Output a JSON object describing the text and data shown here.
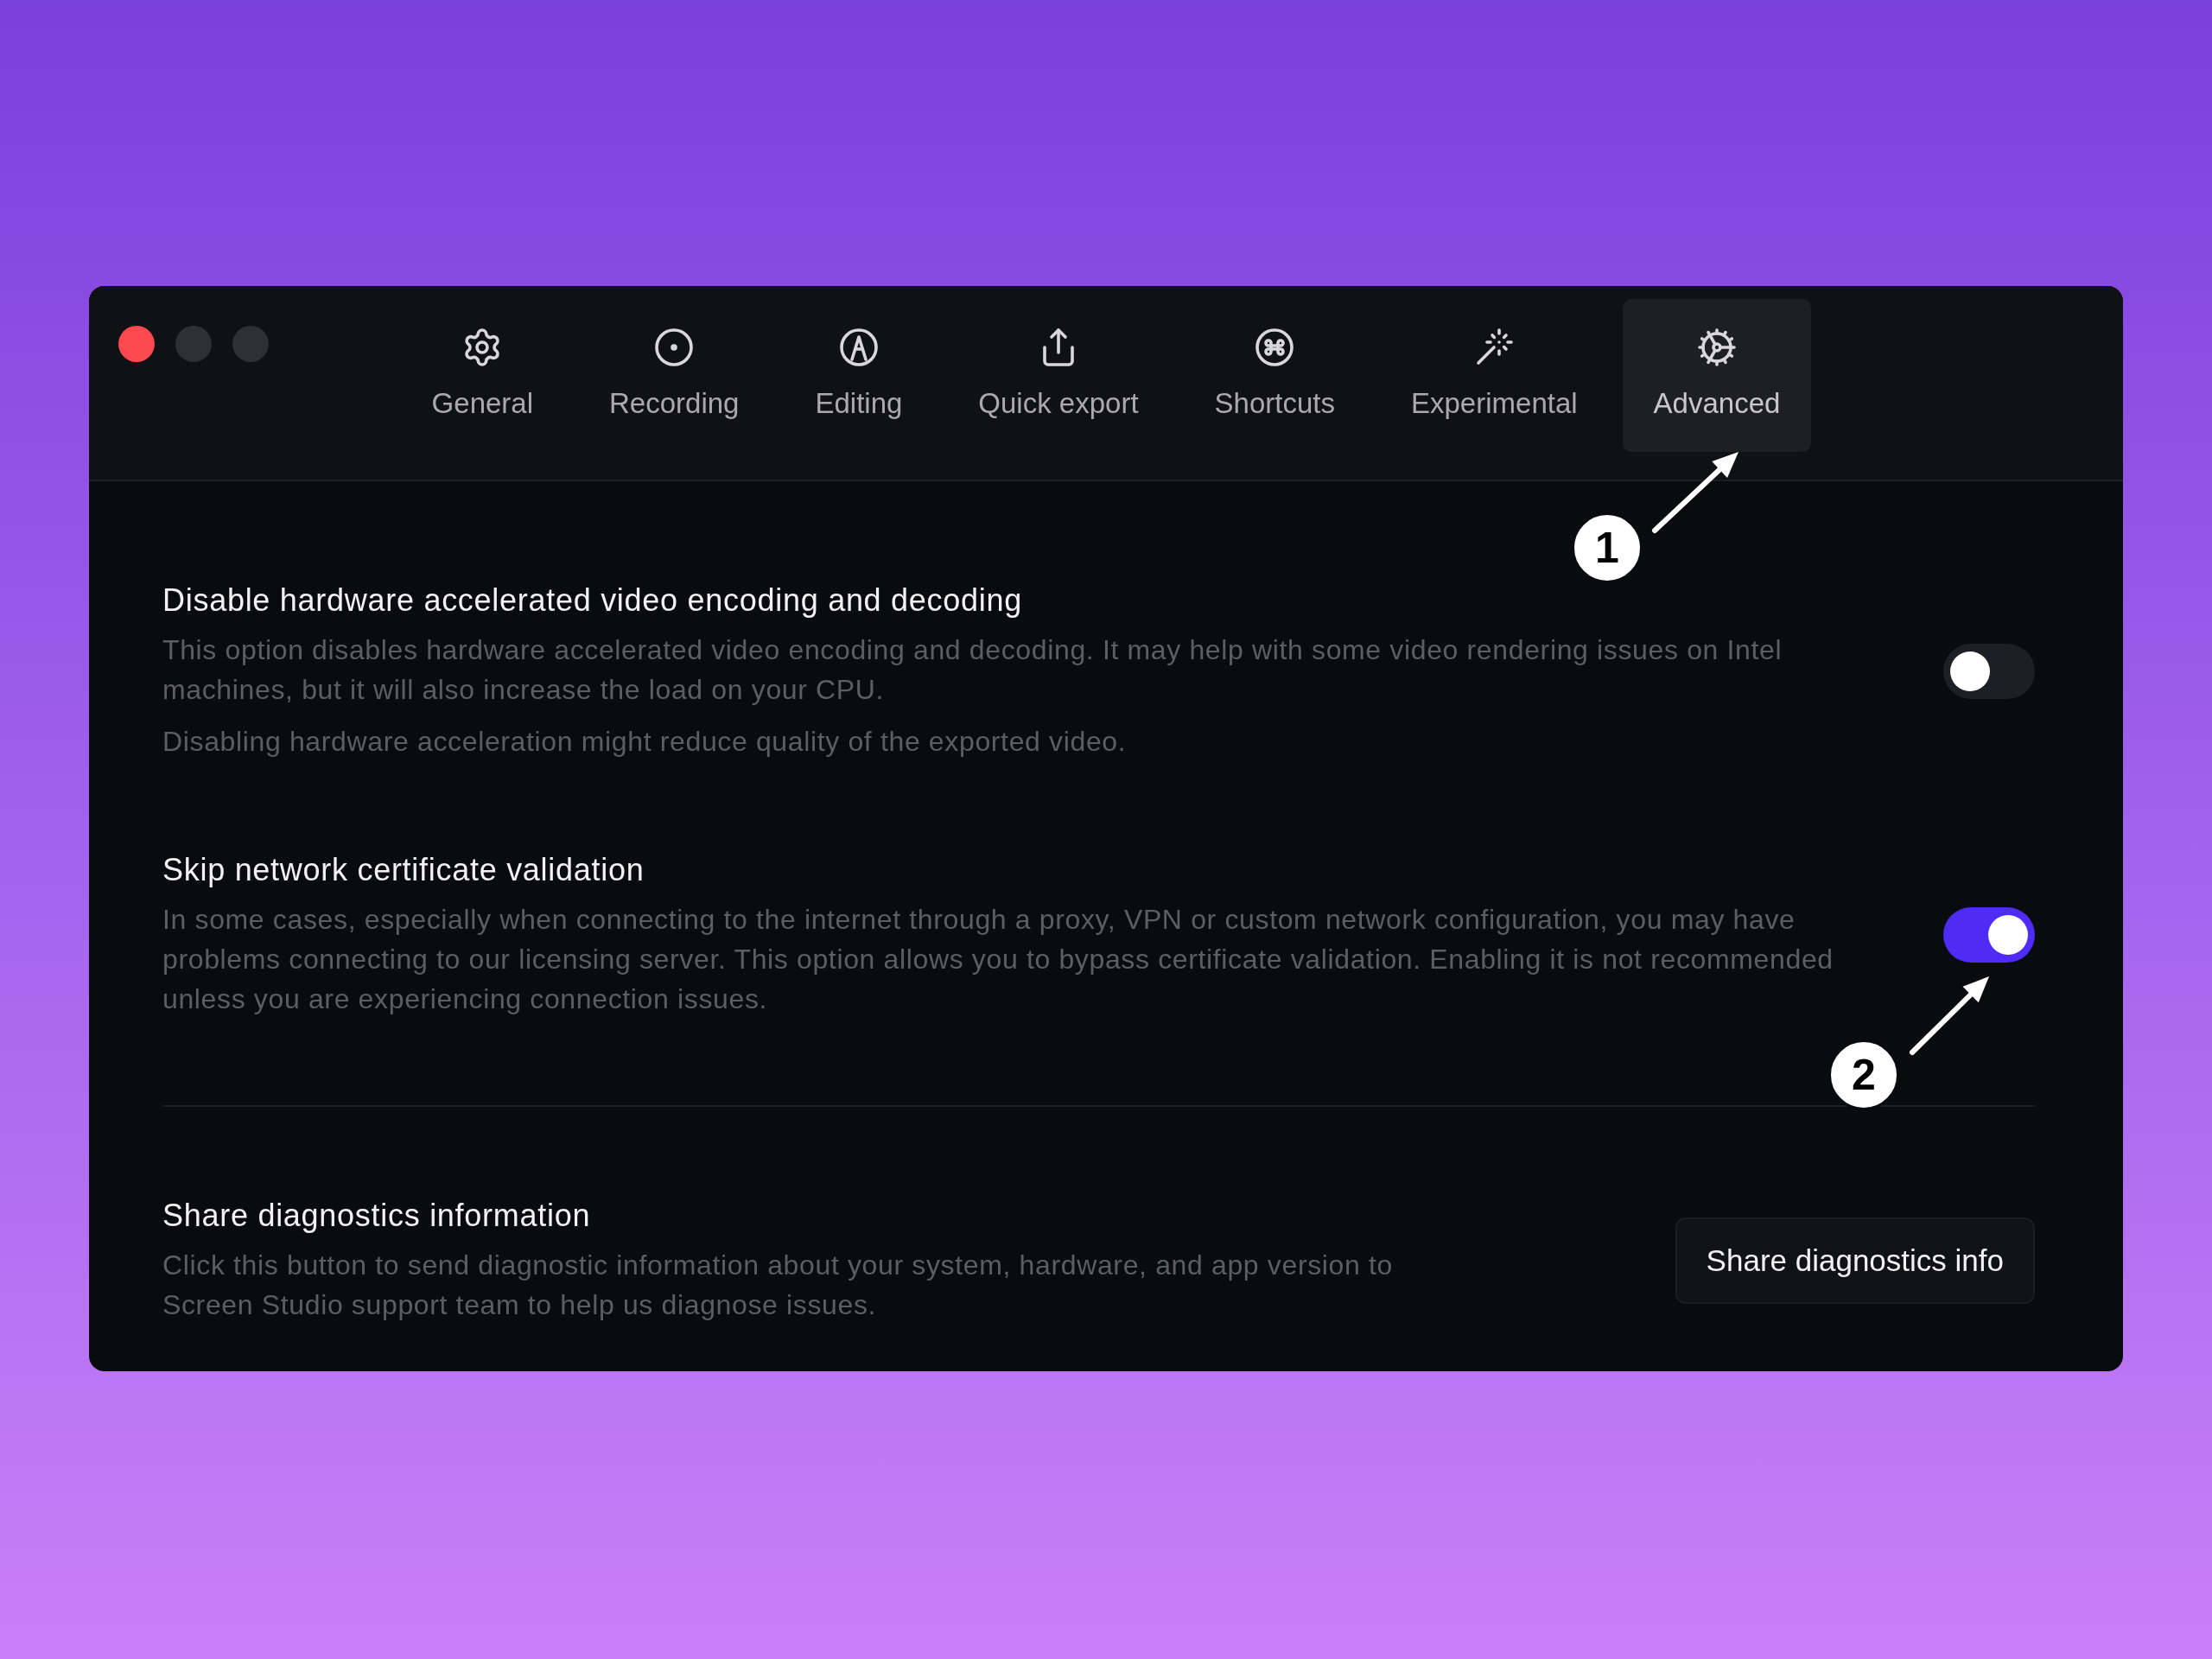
{
  "window": {
    "controls": [
      {
        "color": "#fe4a4f"
      },
      {
        "color": "#2f3034"
      },
      {
        "color": "#2f3034"
      }
    ]
  },
  "tabs": [
    {
      "label": "General",
      "selected": false
    },
    {
      "label": "Recording",
      "selected": false
    },
    {
      "label": "Editing",
      "selected": false
    },
    {
      "label": "Quick export",
      "selected": false
    },
    {
      "label": "Shortcuts",
      "selected": false
    },
    {
      "label": "Experimental",
      "selected": false
    },
    {
      "label": "Advanced",
      "selected": true
    }
  ],
  "settings": [
    {
      "kind": "toggle",
      "title": "Disable hardware accelerated video encoding and decoding",
      "description": [
        "This option disables hardware accelerated video encoding and decoding. It may help with some video rendering issues on Intel machines, but it will also increase the load on your CPU.",
        "Disabling hardware acceleration might reduce quality of the exported video."
      ],
      "on": false
    },
    {
      "kind": "toggle",
      "title": "Skip network certificate validation",
      "description": [
        "In some cases, especially when connecting to the internet through a proxy, VPN or custom network configuration, you may have problems connecting to our licensing server. This option allows you to bypass certificate validation. Enabling it is not recommended unless you are experiencing connection issues."
      ],
      "on": true
    },
    {
      "kind": "button",
      "title": "Share diagnostics information",
      "description": [
        "Click this button to send diagnostic information about your system, hardware, and app version to Screen Studio support team to help us diagnose issues."
      ],
      "button": "Share diagnostics info"
    }
  ],
  "annotations": [
    {
      "label": "1"
    },
    {
      "label": "2"
    }
  ]
}
